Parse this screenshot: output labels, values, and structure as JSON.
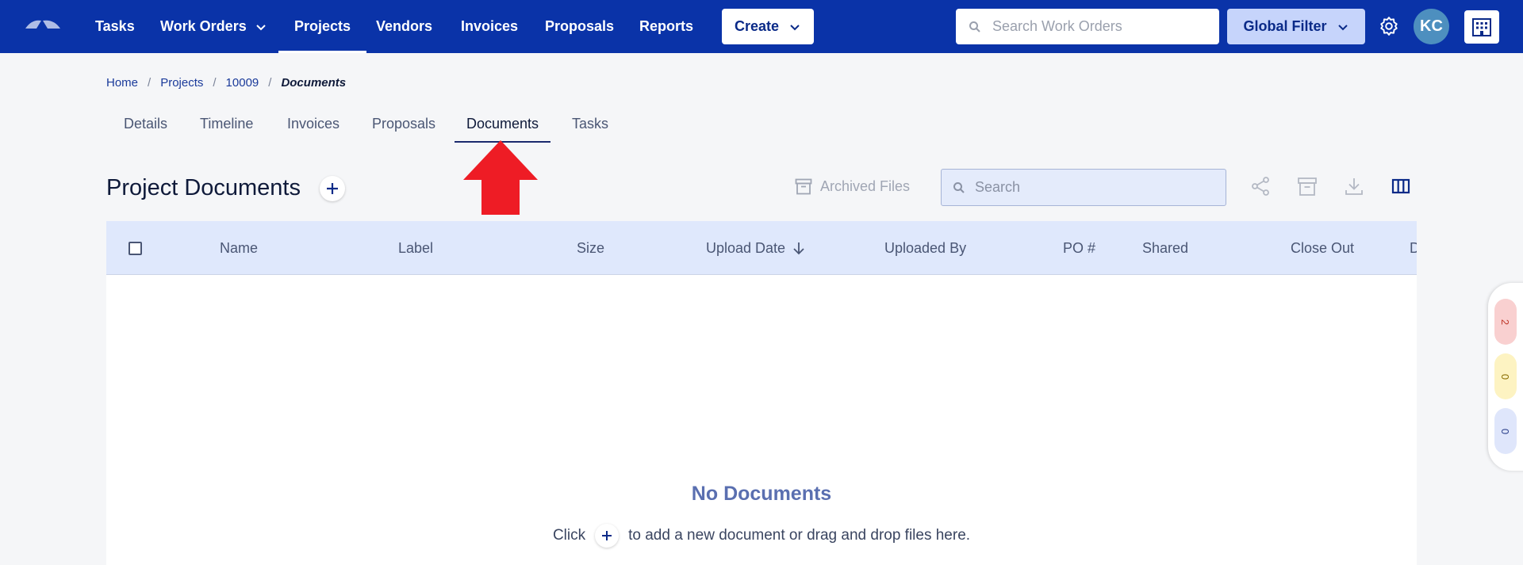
{
  "nav": {
    "items": [
      {
        "label": "Tasks"
      },
      {
        "label": "Work Orders"
      },
      {
        "label": "Projects"
      },
      {
        "label": "Vendors"
      },
      {
        "label": "Invoices"
      },
      {
        "label": "Proposals"
      },
      {
        "label": "Reports"
      }
    ],
    "create_label": "Create",
    "search_placeholder": "Search Work Orders",
    "global_filter_label": "Global Filter",
    "avatar_initials": "KC",
    "brand_color": "#0a33a8"
  },
  "breadcrumb": {
    "home": "Home",
    "projects": "Projects",
    "project_id": "10009",
    "current": "Documents"
  },
  "tabs": [
    {
      "label": "Details"
    },
    {
      "label": "Timeline"
    },
    {
      "label": "Invoices"
    },
    {
      "label": "Proposals"
    },
    {
      "label": "Documents"
    },
    {
      "label": "Tasks"
    }
  ],
  "documents": {
    "title": "Project Documents",
    "archived_label": "Archived Files",
    "search_placeholder": "Search",
    "columns": [
      {
        "label": "Name"
      },
      {
        "label": "Label"
      },
      {
        "label": "Size"
      },
      {
        "label": "Upload Date"
      },
      {
        "label": "Uploaded By"
      },
      {
        "label": "PO #"
      },
      {
        "label": "Shared"
      },
      {
        "label": "Close Out"
      },
      {
        "label": "D"
      }
    ],
    "empty_title": "No Documents",
    "empty_msg_before": "Click",
    "empty_msg_after": "to add a new document or drag and drop files here."
  },
  "side_badges": [
    {
      "count": "2",
      "color": "#f9d0d0",
      "text_color": "#c0392b"
    },
    {
      "count": "0",
      "color": "#fdf3c2",
      "text_color": "#8a6d00"
    },
    {
      "count": "0",
      "color": "#dfe6fb",
      "text_color": "#2a3f8a"
    }
  ]
}
